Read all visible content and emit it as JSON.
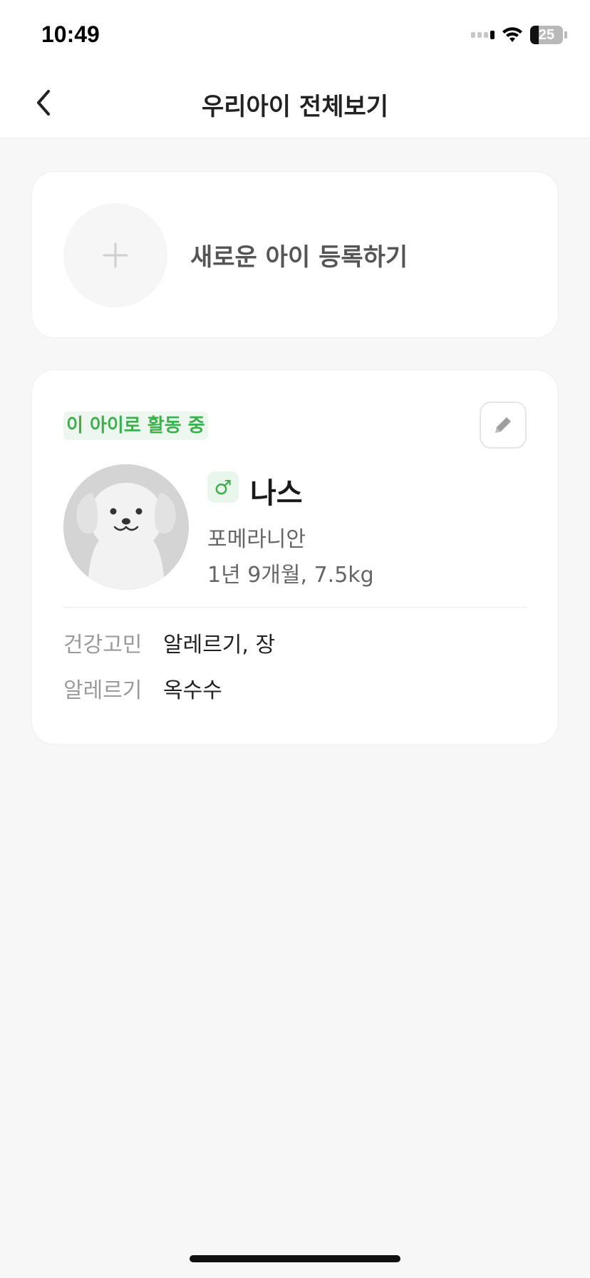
{
  "status": {
    "time": "10:49",
    "battery": "25"
  },
  "header": {
    "title": "우리아이 전체보기",
    "back_icon": "chevron-left-icon"
  },
  "add_card": {
    "label": "새로운 아이 등록하기",
    "icon": "plus-icon"
  },
  "pet_card": {
    "active_badge": "이 아이로 활동 중",
    "gender_symbol": "♂",
    "name": "나스",
    "breed": "포메라니안",
    "age_weight": "1년 9개월, 7.5kg",
    "health_label": "건강고민",
    "health_value": "알레르기, 장",
    "allergy_label": "알레르기",
    "allergy_value": "옥수수"
  },
  "colors": {
    "accent": "#3fae4f",
    "background": "#f7f7f7",
    "card": "#ffffff"
  }
}
